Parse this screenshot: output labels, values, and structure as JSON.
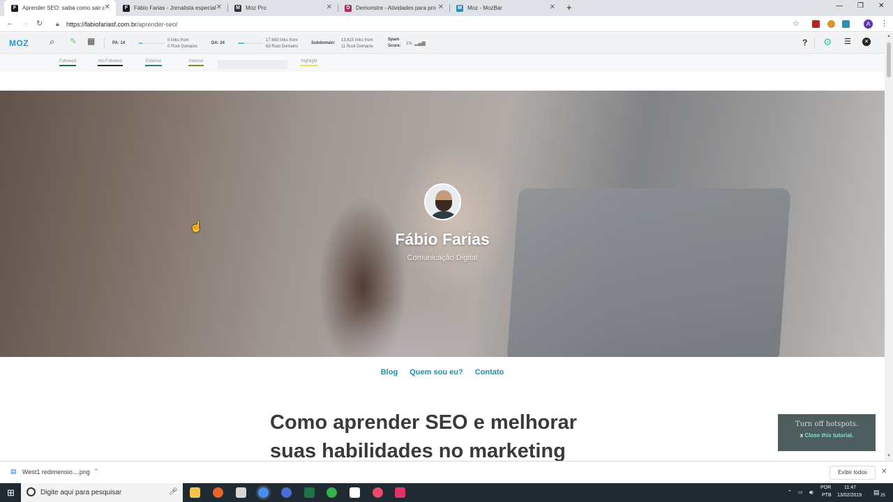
{
  "browser": {
    "tabs": [
      {
        "title": "Aprender SEO: saiba como sair do",
        "favicon": "F"
      },
      {
        "title": "Fábio Farias - Jornalista especialis",
        "favicon": "F"
      },
      {
        "title": "Moz Pro",
        "favicon": "M"
      },
      {
        "title": "Demonstre - Atividades para pro",
        "favicon": "D"
      },
      {
        "title": "Moz - MozBar",
        "favicon": "M"
      }
    ],
    "new_tab": "+",
    "url_host": "https://fabiofariasf.com.br",
    "url_path": "/aprender-seo/",
    "profile_initial": "A"
  },
  "mozbar": {
    "logo": "MOZ",
    "pa_label": "PA: 14",
    "pa_links_line1": "0 links from",
    "pa_links_line2": "0 Root Domains",
    "da_label": "DA: 24",
    "da_links_line1": "17,683 links from",
    "da_links_line2": "63 Root Domains",
    "subdomain_label": "Subdomain:",
    "sub_links_line1": "13,615 links from",
    "sub_links_line2": "11 Root Domains",
    "spam_label_1": "Spam",
    "spam_label_2": "Score:",
    "spam_value": "1%",
    "help": "?",
    "pa_fill": 0.14,
    "da_fill": 0.24,
    "link_filters": [
      {
        "label": "Followed",
        "color": "#1f6b4a"
      },
      {
        "label": "No-Followed",
        "color": "#222222"
      },
      {
        "label": "External",
        "color": "#2a7f6a"
      },
      {
        "label": "Internal",
        "color": "#7a8a2a"
      },
      {
        "label": "Highlight",
        "color": "#e6e65a"
      }
    ]
  },
  "page": {
    "hero_name": "Fábio Farias",
    "hero_subtitle": "Comunicação Digital",
    "nav": [
      "Blog",
      "Quem sou eu?",
      "Contato"
    ],
    "article_title_line1": "Como aprender SEO e melhorar",
    "article_title_line2": "suas habilidades no marketing"
  },
  "hotspot": {
    "title": "Turn off hotspots.",
    "close_x": "x",
    "close_link": "Close this tutorial."
  },
  "downloads": {
    "file": "West1 redimensio....png",
    "show_all": "Exibir todos"
  },
  "taskbar": {
    "search_placeholder": "Digite aqui para pesquisar",
    "lang_1": "POR",
    "lang_2": "PTB",
    "time": "11:47",
    "date": "13/02/2019",
    "notif_count": "25"
  }
}
